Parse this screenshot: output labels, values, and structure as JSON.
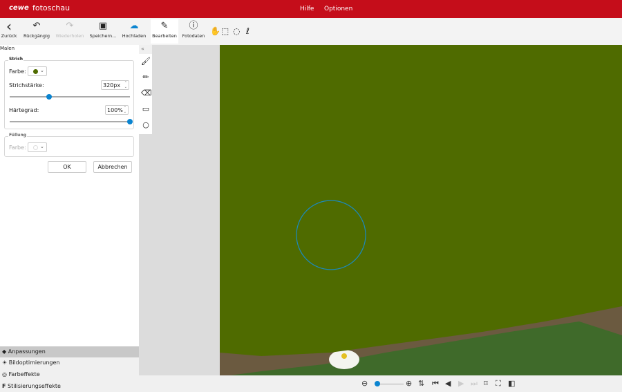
{
  "header": {
    "logo": "cewe",
    "app_name": "fotoschau",
    "menu": [
      "Hilfe",
      "Optionen"
    ]
  },
  "toolbar": {
    "items": [
      {
        "label": "Zurück",
        "icon": "chevron-left-icon",
        "glyph": "‹"
      },
      {
        "label": "Rückgängig",
        "icon": "undo-icon",
        "glyph": "↶"
      },
      {
        "label": "Wiederholen",
        "icon": "redo-icon",
        "glyph": "↷",
        "disabled": true
      },
      {
        "label": "Speichern...",
        "icon": "save-icon",
        "glyph": "▣"
      },
      {
        "label": "Hochladen",
        "icon": "cloud-upload-icon",
        "glyph": "☁"
      },
      {
        "label": "Bearbeiten",
        "icon": "edit-icon",
        "glyph": "✎",
        "active": true
      },
      {
        "label": "Fotodaten",
        "icon": "info-icon",
        "glyph": "ⓘ"
      }
    ],
    "tools": [
      {
        "icon": "hand-icon",
        "glyph": "✋"
      },
      {
        "icon": "rect-select-icon",
        "glyph": "⬚"
      },
      {
        "icon": "ellipse-select-icon",
        "glyph": "◌"
      },
      {
        "icon": "lasso-icon",
        "glyph": "ℓ"
      }
    ]
  },
  "panel": {
    "title": "Malen",
    "collapse": "«",
    "stroke": {
      "title": "Strich",
      "color_label": "Farbe:",
      "color": "#4f6b00",
      "width_label": "Strichstärke:",
      "width_value": "320px",
      "width_fraction": 0.33,
      "hardness_label": "Härtegrad:",
      "hardness_value": "100%",
      "hardness_fraction": 1.0
    },
    "fill": {
      "title": "Füllung",
      "color_label": "Farbe:"
    },
    "ok": "OK",
    "cancel": "Abbrechen"
  },
  "side_tools": [
    {
      "icon": "brush-icon",
      "glyph": "🖌"
    },
    {
      "icon": "pencil-icon",
      "glyph": "✏"
    },
    {
      "icon": "eraser-icon",
      "glyph": "⌫"
    },
    {
      "icon": "rectangle-icon",
      "glyph": "▭"
    },
    {
      "icon": "circle-icon",
      "glyph": "○"
    }
  ],
  "accordion": [
    {
      "label": "Anpassungen",
      "glyph": "◆"
    },
    {
      "label": "Bildoptimierungen",
      "glyph": "☀"
    },
    {
      "label": "Farbeffekte",
      "glyph": "◎"
    },
    {
      "label": "Stilisierungseffekte",
      "glyph": "F"
    }
  ],
  "bottom": [
    {
      "icon": "zoom-out-icon",
      "glyph": "⊖"
    },
    {
      "icon": "zoom-in-icon",
      "glyph": "⊕"
    },
    {
      "icon": "fit-icon",
      "glyph": "⇅"
    },
    {
      "icon": "first-icon",
      "glyph": "⏮"
    },
    {
      "icon": "prev-icon",
      "glyph": "◀"
    },
    {
      "icon": "next-icon",
      "glyph": "▶"
    },
    {
      "icon": "last-icon",
      "glyph": "⏭"
    },
    {
      "icon": "bookmark-icon",
      "glyph": "⌑"
    },
    {
      "icon": "fullscreen-icon",
      "glyph": "⛶"
    },
    {
      "icon": "compare-icon",
      "glyph": "◧"
    }
  ],
  "zoom_fraction": 0.1,
  "colors": {
    "brand": "#c50d1a",
    "accent": "#0a84d0",
    "paint": "#4f6b00"
  }
}
